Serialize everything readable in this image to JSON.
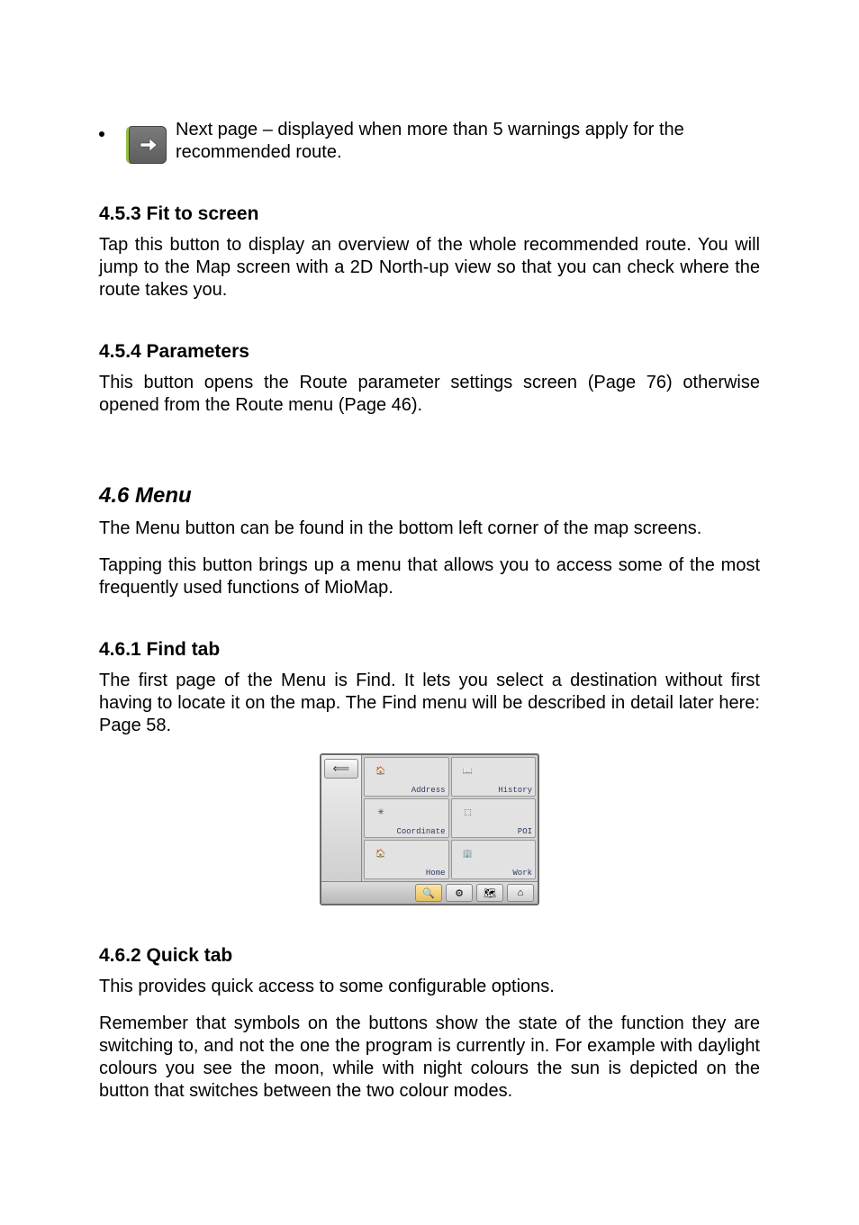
{
  "bullet": {
    "icon": "arrow-right-icon",
    "text": " Next page – displayed when more than 5 warnings apply for the recommended route."
  },
  "s453": {
    "heading": "4.5.3  Fit to screen",
    "para": "Tap this button to display an overview of the whole recommended route. You will jump to the Map screen with a 2D North-up view so that you can check where the route takes you."
  },
  "s454": {
    "heading": "4.5.4  Parameters",
    "para": "This button opens the Route parameter settings screen (Page 76) otherwise opened from the Route menu (Page 46)."
  },
  "s46": {
    "heading": "4.6  Menu",
    "p1": "The Menu button can be found in the bottom left corner of the map screens.",
    "p2": "Tapping this button brings up a menu that allows you to access some of the most frequently used functions of MioMap."
  },
  "s461": {
    "heading": "4.6.1  Find tab",
    "para": "The first page of the Menu is Find. It lets you select a destination without first having to locate it on the map. The Find menu will be described in detail later here: Page 58."
  },
  "shot": {
    "back": "⟸",
    "cells": [
      {
        "icon": "🏠",
        "label": "Address"
      },
      {
        "icon": "📖",
        "label": "History"
      },
      {
        "icon": "✳",
        "label": "Coordinate"
      },
      {
        "icon": "⬚",
        "label": "POI"
      },
      {
        "icon": "🏠",
        "label": "Home"
      },
      {
        "icon": "🏢",
        "label": "Work"
      }
    ],
    "bottom": [
      "🔍",
      "⚙",
      "🗺",
      "⌂"
    ]
  },
  "s462": {
    "heading": "4.6.2  Quick tab",
    "p1": "This provides quick access to some configurable options.",
    "p2": "Remember that symbols on the buttons show the state of the function they are switching to, and not the one the program is currently in. For example with daylight colours you see the moon, while with night colours the sun is depicted on the button that switches between the two colour modes."
  }
}
